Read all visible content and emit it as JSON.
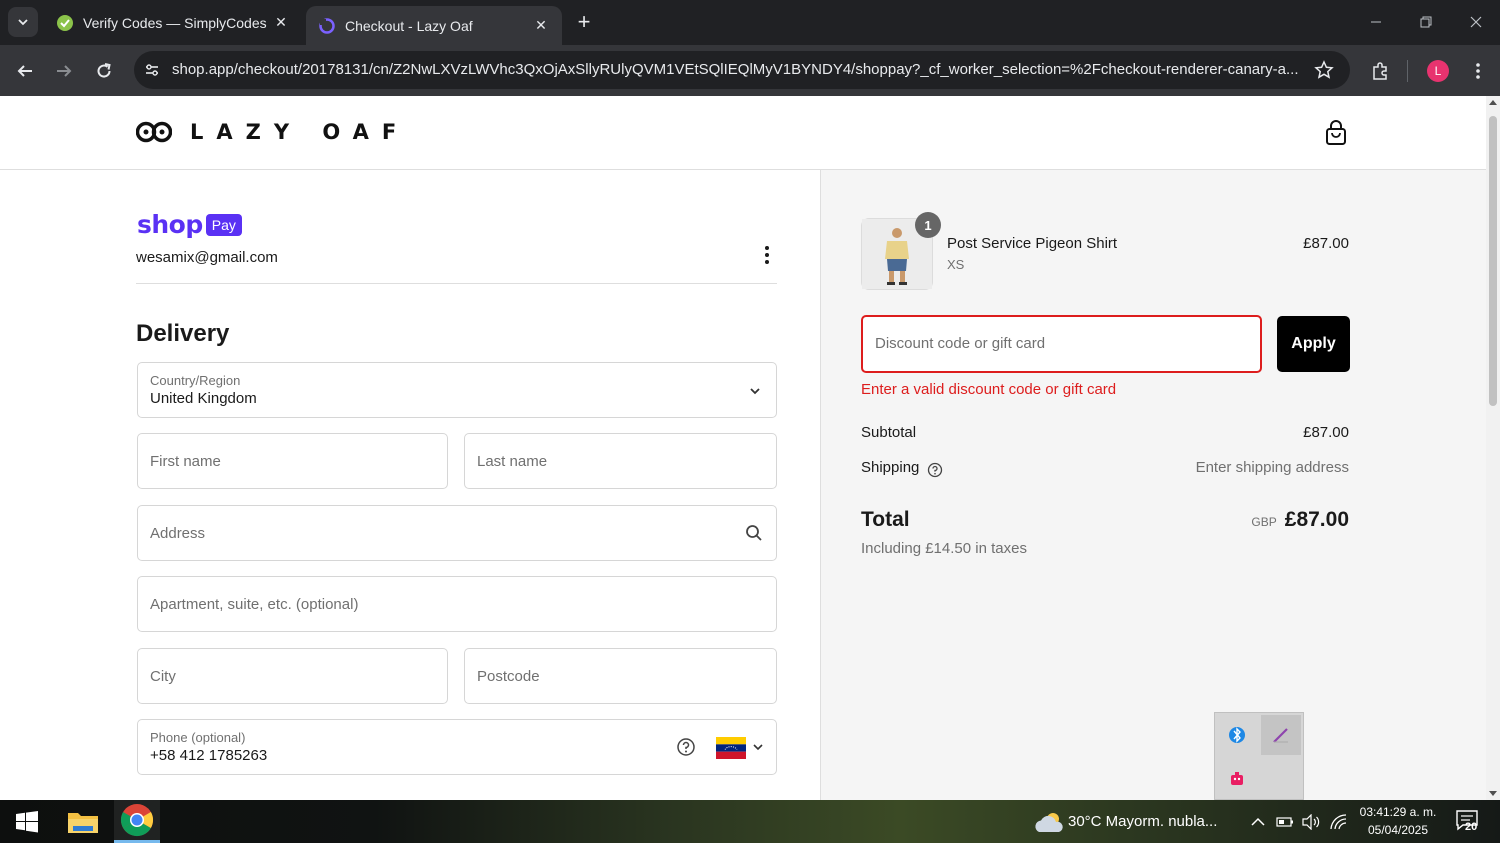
{
  "browser": {
    "tabs": [
      {
        "title": "Verify Codes — SimplyCodes",
        "icon": "simplycodes-icon",
        "active": false
      },
      {
        "title": "Checkout - Lazy Oaf",
        "icon": "shop-icon",
        "active": true
      }
    ],
    "url": "shop.app/checkout/20178131/cn/Z2NwLXVzLWVhc3QxOjAxSllyRUlyQVM1VEtSQlIEQlMyV1BYNDY4/shoppay?_cf_worker_selection=%2Fcheckout-renderer-canary-a...",
    "profile_initial": "L"
  },
  "header": {
    "logo_text": "LAZY OAF",
    "cart_icon": "shopping-bag-icon"
  },
  "shoppay": {
    "shop_word": "shop",
    "pay_badge": "Pay",
    "email": "wesamix@gmail.com"
  },
  "delivery": {
    "title": "Delivery",
    "country_label": "Country/Region",
    "country_value": "United Kingdom",
    "first_name_placeholder": "First name",
    "last_name_placeholder": "Last name",
    "address_placeholder": "Address",
    "apartment_placeholder": "Apartment, suite, etc. (optional)",
    "city_placeholder": "City",
    "postcode_placeholder": "Postcode",
    "phone_label": "Phone (optional)",
    "phone_value": "+58 412 1785263"
  },
  "summary": {
    "item": {
      "name": "Post Service Pigeon Shirt",
      "variant": "XS",
      "price": "£87.00",
      "quantity": "1"
    },
    "discount_placeholder": "Discount code or gift card",
    "apply_label": "Apply",
    "error": "Enter a valid discount code or gift card",
    "subtotal_label": "Subtotal",
    "subtotal_value": "£87.00",
    "shipping_label": "Shipping",
    "shipping_value": "Enter shipping address",
    "total_label": "Total",
    "total_currency": "GBP",
    "total_value": "£87.00",
    "taxes": "Including £14.50 in taxes"
  },
  "taskbar": {
    "weather": "30°C  Mayorm. nubla...",
    "time": "03:41:29 a. m.",
    "date": "05/04/2025",
    "notifications": "20"
  },
  "colors": {
    "shop_purple": "#5a31f4",
    "error_red": "#dd1d1d",
    "apply_black": "#000000"
  }
}
